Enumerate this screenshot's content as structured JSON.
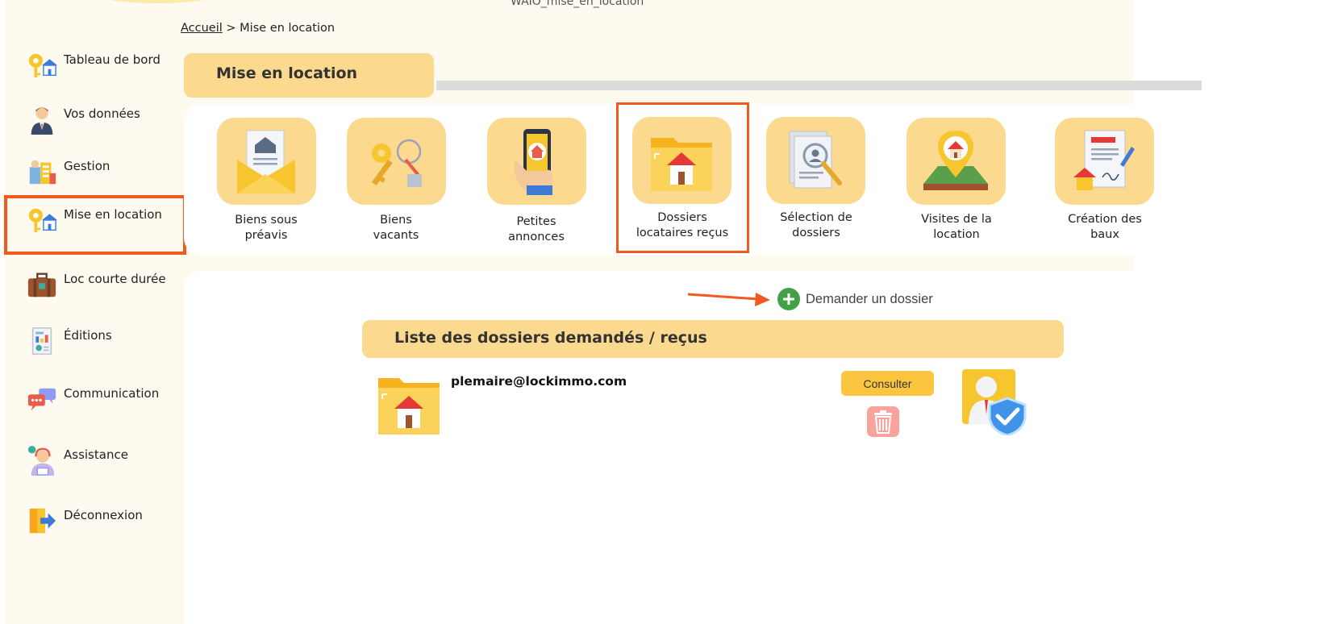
{
  "window_title": "WAIO_mise_en_location",
  "breadcrumb": {
    "home": "Accueil",
    "separator": " > ",
    "current": "Mise en location"
  },
  "sidebar": {
    "items": [
      {
        "label": "Tableau de bord",
        "icon": "key-house-icon"
      },
      {
        "label": "Vos données",
        "icon": "user-icon"
      },
      {
        "label": "Gestion",
        "icon": "management-icon"
      },
      {
        "label": "Mise en location",
        "icon": "key-house-icon",
        "active": true
      },
      {
        "label": "Loc courte durée",
        "icon": "suitcase-icon"
      },
      {
        "label": "Éditions",
        "icon": "report-icon"
      },
      {
        "label": "Communication",
        "icon": "chat-icon"
      },
      {
        "label": "Assistance",
        "icon": "support-agent-icon"
      },
      {
        "label": "Déconnexion",
        "icon": "logout-icon"
      }
    ]
  },
  "section": {
    "title": "Mise en location"
  },
  "tiles": [
    {
      "line1": "Biens sous",
      "line2": "préavis",
      "icon": "notice-envelope-icon"
    },
    {
      "line1": "Biens",
      "line2": "vacants",
      "icon": "keys-icon"
    },
    {
      "line1": "Petites",
      "line2": "annonces",
      "icon": "phone-house-icon"
    },
    {
      "line1": "Dossiers",
      "line2": "locataires reçus",
      "icon": "folder-house-icon",
      "highlighted": true
    },
    {
      "line1": "Sélection de",
      "line2": "dossiers",
      "icon": "document-search-icon"
    },
    {
      "line1": "Visites de la",
      "line2": "location",
      "icon": "location-pin-house-icon"
    },
    {
      "line1": "Création des",
      "line2": "baux",
      "icon": "contract-icon"
    }
  ],
  "request": {
    "label": "Demander un dossier"
  },
  "list": {
    "title": "Liste des dossiers demandés / reçus",
    "rows": [
      {
        "email": "plemaire@lockimmo.com",
        "consult_label": "Consulter"
      }
    ]
  },
  "colors": {
    "accent": "#fbd98e",
    "highlight": "#f05a1e",
    "background": "#fffaef",
    "button": "#fcc540",
    "add": "#43a047"
  }
}
